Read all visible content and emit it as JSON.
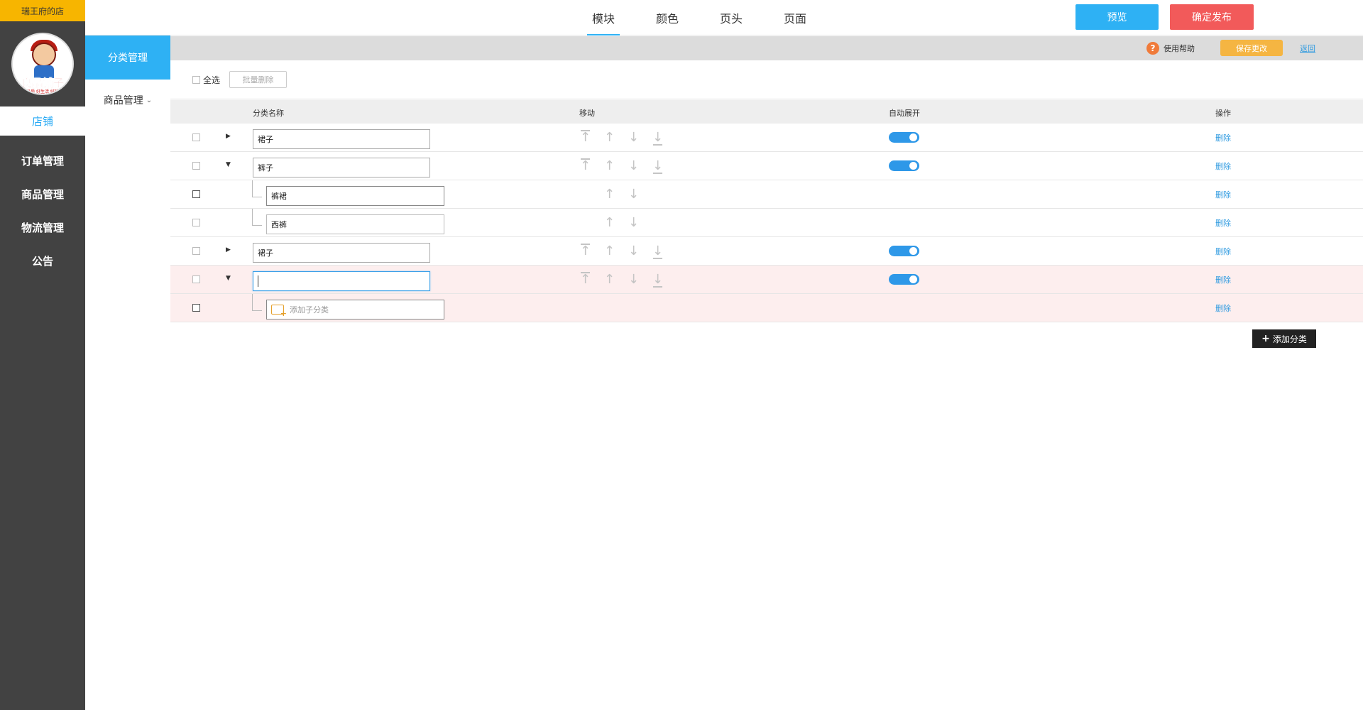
{
  "store": {
    "name": "瑞王府的店",
    "logo_text": "良品铺子",
    "logo_sub": "好品质 好生活 好味道"
  },
  "sidebar": {
    "items": [
      {
        "label": "店铺",
        "active": true
      },
      {
        "label": "订单管理"
      },
      {
        "label": "商品管理"
      },
      {
        "label": "物流管理"
      },
      {
        "label": "公告"
      }
    ]
  },
  "subnav": {
    "category_label": "分类管理",
    "goods_label": "商品管理"
  },
  "topbar": {
    "tabs": [
      {
        "label": "模块",
        "active": true
      },
      {
        "label": "颜色"
      },
      {
        "label": "页头"
      },
      {
        "label": "页面"
      }
    ],
    "preview_label": "预览",
    "publish_label": "确定发布"
  },
  "toolbar": {
    "help_label": "使用帮助",
    "save_label": "保存更改",
    "back_label": "返回"
  },
  "actions": {
    "select_all_label": "全选",
    "bulk_delete_label": "批量删除"
  },
  "table": {
    "columns": {
      "name": "分类名称",
      "move": "移动",
      "auto_expand": "自动展开",
      "ops": "操作"
    },
    "delete_label": "删除",
    "rows": [
      {
        "name": "裙子",
        "level": 1,
        "expanded": false,
        "auto_expand": true
      },
      {
        "name": "裤子",
        "level": 1,
        "expanded": true,
        "auto_expand": true
      },
      {
        "name": "裤裙",
        "level": 2
      },
      {
        "name": "西裤",
        "level": 2
      },
      {
        "name": "裙子",
        "level": 1,
        "expanded": false,
        "auto_expand": true
      },
      {
        "name": "",
        "level": 1,
        "expanded": true,
        "auto_expand": true,
        "editing": true
      },
      {
        "name": "",
        "level": 2,
        "placeholder": "添加子分类"
      }
    ]
  },
  "add_category_label": "添加分类",
  "colors": {
    "accent": "#2eb1f4",
    "danger": "#f25a5a",
    "save": "#f5b542",
    "sidebar": "#424242"
  }
}
